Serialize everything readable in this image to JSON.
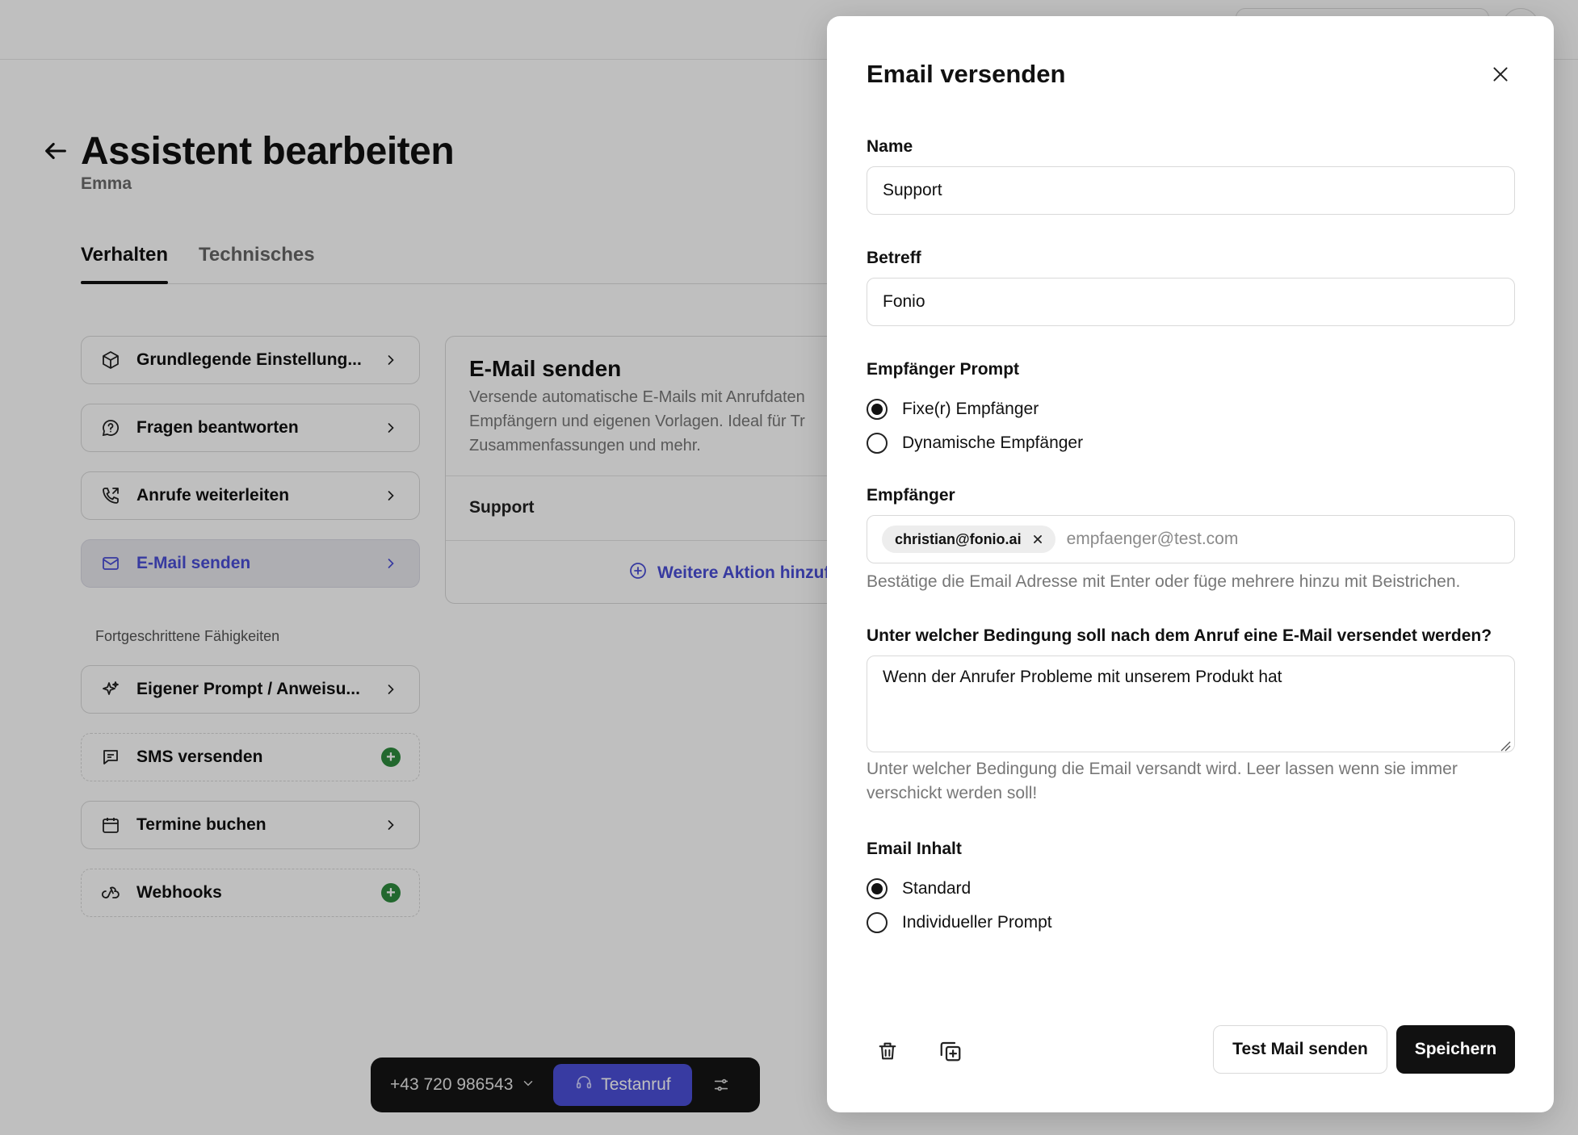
{
  "page": {
    "title": "Assistent bearbeiten",
    "subtitle": "Emma",
    "tabs": [
      {
        "label": "Verhalten",
        "active": true
      },
      {
        "label": "Technisches",
        "active": false
      }
    ]
  },
  "sidebar": {
    "items": [
      {
        "label": "Grundlegende Einstellung...",
        "icon": "cube-icon",
        "trail": "chevron"
      },
      {
        "label": "Fragen beantworten",
        "icon": "chat-question-icon",
        "trail": "chevron"
      },
      {
        "label": "Anrufe weiterleiten",
        "icon": "phone-forward-icon",
        "trail": "chevron"
      },
      {
        "label": "E-Mail senden",
        "icon": "mail-icon",
        "trail": "chevron",
        "active": true
      }
    ],
    "advanced_label": "Fortgeschrittene Fähigkeiten",
    "advanced_items": [
      {
        "label": "Eigener Prompt / Anweisu...",
        "icon": "sparkles-icon",
        "trail": "chevron"
      },
      {
        "label": "SMS versenden",
        "icon": "message-icon",
        "trail": "plus"
      },
      {
        "label": "Termine buchen",
        "icon": "calendar-icon",
        "trail": "chevron"
      },
      {
        "label": "Webhooks",
        "icon": "webhook-icon",
        "trail": "plus"
      }
    ]
  },
  "card": {
    "title": "E-Mail senden",
    "description": "Versende automatische E-Mails mit Anrufdaten an Empfängern und eigenen Vorlagen. Ideal für Tr Zusammenfassungen und mehr.",
    "desc_lines": [
      "Versende automatische E-Mails mit Anrufdaten",
      "Empfängern und eigenen Vorlagen. Ideal für Tr",
      "Zusammenfassungen und mehr."
    ],
    "row": "Support",
    "add_label": "Weitere Aktion hinzuf"
  },
  "callbar": {
    "number": "+43 720 986543",
    "test_label": "Testanruf"
  },
  "modal": {
    "title": "Email versenden",
    "name_label": "Name",
    "name_value": "Support",
    "subject_label": "Betreff",
    "subject_value": "Fonio",
    "recipient_prompt_label": "Empfänger Prompt",
    "recipient_options": [
      {
        "label": "Fixe(r) Empfänger",
        "selected": true
      },
      {
        "label": "Dynamische Empfänger",
        "selected": false
      }
    ],
    "recipients_label": "Empfänger",
    "recipient_chip": "christian@fonio.ai",
    "recipient_placeholder": "empfaenger@test.com",
    "recipients_help": "Bestätige die Email Adresse mit Enter oder füge mehrere hinzu mit Beistrichen.",
    "condition_label": "Unter welcher Bedingung soll nach dem Anruf eine E-Mail versendet werden?",
    "condition_value": "Wenn der Anrufer Probleme mit unserem Produkt hat",
    "condition_help": "Unter welcher Bedingung die Email versandt wird. Leer lassen wenn sie immer verschickt werden soll!",
    "content_label": "Email Inhalt",
    "content_options": [
      {
        "label": "Standard",
        "selected": true
      },
      {
        "label": "Individueller Prompt",
        "selected": false
      }
    ],
    "test_mail_label": "Test Mail senden",
    "save_label": "Speichern"
  },
  "colors": {
    "accent": "#4a4ed6",
    "success": "#2e8b3e",
    "primary_button": "#111111"
  }
}
